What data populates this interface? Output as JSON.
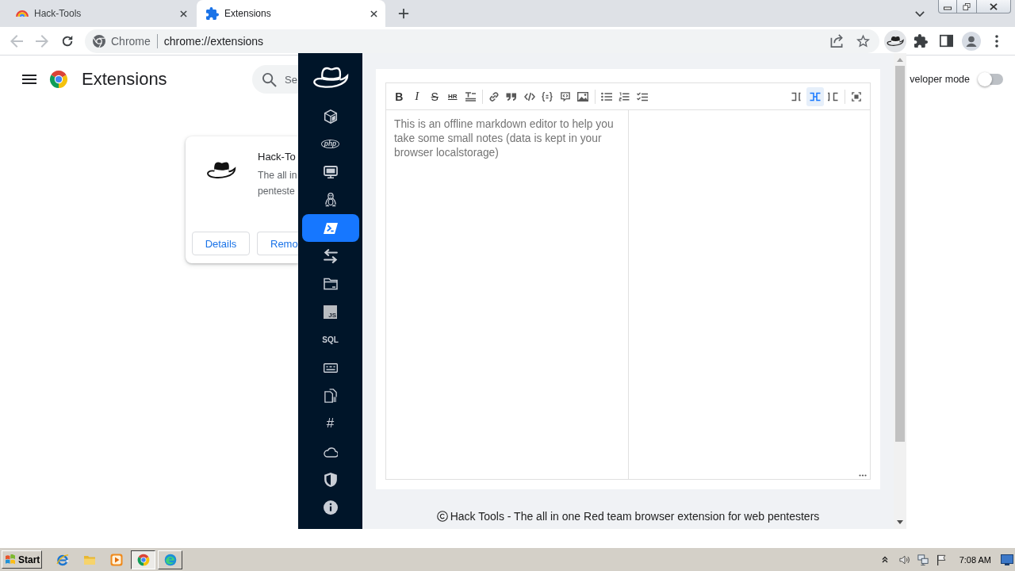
{
  "browser": {
    "tabs": [
      {
        "title": "Hack-Tools",
        "selected": false
      },
      {
        "title": "Extensions",
        "selected": true
      }
    ],
    "omnibox": {
      "site_chip": "Chrome",
      "url": "chrome://extensions"
    }
  },
  "extensions_page": {
    "title": "Extensions",
    "search": {
      "placeholder": "Se"
    },
    "developer_mode": {
      "label": "veloper mode",
      "on": false
    },
    "card": {
      "name": "Hack-To",
      "description_lines": [
        "The all in",
        "penteste"
      ],
      "buttons": [
        "Details",
        "Remo"
      ]
    }
  },
  "popup": {
    "sidebar": {
      "items": [
        {
          "kind": "icon",
          "selected": false
        },
        {
          "kind": "badge",
          "label": "php",
          "selected": false
        },
        {
          "kind": "icon",
          "selected": false
        },
        {
          "kind": "icon",
          "selected": false
        },
        {
          "kind": "icon",
          "selected": true
        },
        {
          "kind": "icon",
          "selected": false
        },
        {
          "kind": "icon",
          "selected": false
        },
        {
          "kind": "tile",
          "label": "JS",
          "selected": false
        },
        {
          "kind": "text",
          "label": "SQL",
          "selected": false
        },
        {
          "kind": "icon",
          "selected": false
        },
        {
          "kind": "icon",
          "selected": false
        },
        {
          "kind": "text",
          "label": "#",
          "selected": false
        },
        {
          "kind": "icon",
          "selected": false
        },
        {
          "kind": "icon",
          "selected": false
        },
        {
          "kind": "icon",
          "selected": false
        }
      ]
    },
    "editor": {
      "toolbar_groups": [
        [
          {
            "kind": "bold",
            "text": "B"
          },
          {
            "kind": "italic",
            "text": "I"
          },
          {
            "kind": "strike",
            "text": "S"
          },
          {
            "kind": "hr",
            "text": "HR"
          },
          {
            "kind": "title"
          }
        ],
        [
          {
            "kind": "link"
          },
          {
            "kind": "quote"
          },
          {
            "kind": "code"
          },
          {
            "kind": "code-block"
          },
          {
            "kind": "comment"
          },
          {
            "kind": "image"
          }
        ],
        [
          {
            "kind": "bullet-list"
          },
          {
            "kind": "numbered-list"
          },
          {
            "kind": "task-list"
          }
        ]
      ],
      "view_modes": [
        {
          "selected": false
        },
        {
          "selected": true
        },
        {
          "selected": false
        }
      ],
      "placeholder": "This is an offline markdown editor to help you take some small notes (data is kept in your browser localstorage)"
    },
    "footer": "Hack Tools - The all in one Red team browser extension for web pentesters"
  },
  "taskbar": {
    "start": "Start",
    "windows": [
      {
        "selected": true
      },
      {
        "selected": false
      }
    ],
    "clock": "7:08 AM"
  }
}
